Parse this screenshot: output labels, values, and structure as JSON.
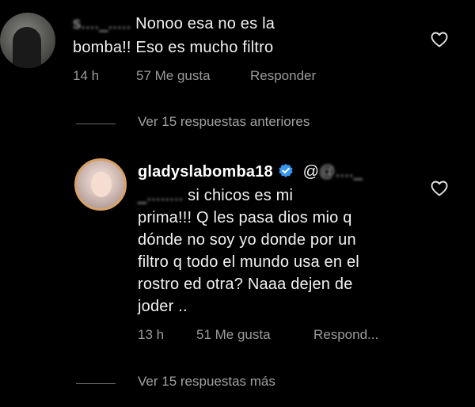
{
  "comment_1": {
    "username": "s...._.....",
    "text_line_1": "Nonoo esa no es la",
    "text_line_2": "bomba!! Eso es mucho filtro",
    "time": "14 h",
    "likes": "57 Me gusta",
    "reply_label": "Responder",
    "icon": "heart-icon"
  },
  "view_previous": {
    "label": "Ver 15 respuestas anteriores"
  },
  "comment_2": {
    "username": "gladyslabomba18",
    "mention": "@...._",
    "mention_cont": "_........",
    "text_line_1_rest": "si chicos  es  mi",
    "text_line_2": "prima!!! Q les pasa dios  mio q",
    "text_line_3": "dónde  no soy yo  donde por un",
    "text_line_4": "filtro  q todo  el mundo usa  en el",
    "text_line_5": "rostro  ed otra? Naaa dejen  de",
    "text_line_6": "joder ..",
    "time": "13 h",
    "likes": "51 Me gusta",
    "reply_label": "Respond...",
    "icons": [
      "verified-icon",
      "heart-icon"
    ],
    "accent_color": "#3897f0"
  },
  "view_more": {
    "label": "Ver 15 respuestas más"
  }
}
